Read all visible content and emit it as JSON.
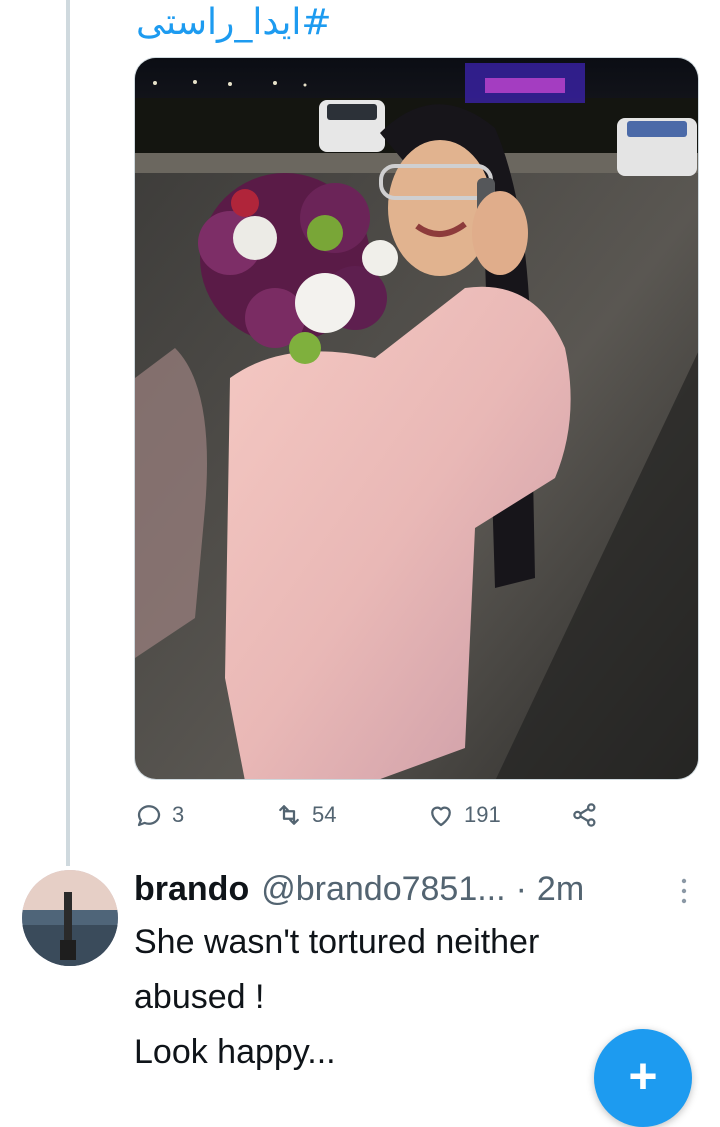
{
  "tweet": {
    "hashtag": "#ایدا_راستی",
    "media_alt": "photo",
    "actions": {
      "reply_count": "3",
      "retweet_count": "54",
      "like_count": "191"
    }
  },
  "reply": {
    "display_name": "brando",
    "handle": "@brando7851...",
    "separator": "·",
    "time": "2m",
    "lines": [
      "She wasn't tortured neither",
      "abused !",
      "Look happy..."
    ]
  },
  "fab": {
    "label": "+"
  },
  "colors": {
    "accent": "#1d9bf0",
    "muted": "#536471",
    "thread_line": "#cfd9de"
  },
  "icons": [
    "reply-icon",
    "retweet-icon",
    "like-icon",
    "share-icon",
    "more-vertical-icon",
    "compose-plus-icon"
  ]
}
